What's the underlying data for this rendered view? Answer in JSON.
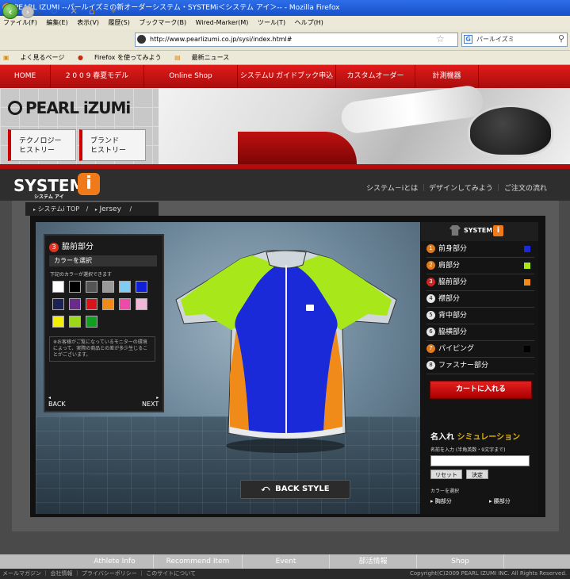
{
  "browser": {
    "title": "PEARL IZUMI --パールイズミの新オーダーシステム・SYSTEMi＜システム アイ＞-- - Mozilla Firefox",
    "menu": [
      "ファイル(F)",
      "編集(E)",
      "表示(V)",
      "履歴(S)",
      "ブックマーク(B)",
      "Wired-Marker(M)",
      "ツール(T)",
      "ヘルプ(H)"
    ],
    "url": "http://www.pearlizumi.co.jp/sysi/index.html#",
    "search": "パールイズミ",
    "bookmarks": [
      "よく見るページ",
      "Firefox を使ってみよう",
      "最新ニュース"
    ]
  },
  "site_nav": [
    "HOME",
    "2 0 0 9 春夏モデル",
    "Online Shop",
    "システムU ガイドブック申込",
    "カスタムオーダー",
    "計測機器"
  ],
  "banner": {
    "logo": "PEARL iZUMi",
    "btn_tech": [
      "テクノロジー",
      "ヒストリー"
    ],
    "btn_brand": [
      "ブランド",
      "ヒストリー"
    ]
  },
  "system": {
    "logo": "SYSTEM",
    "logo_sub": "システム アイ",
    "logo_i": "i",
    "links": [
      "システム－iとは",
      "デザインしてみよう",
      "ご注文の流れ"
    ]
  },
  "breadcrumb": {
    "home": "システムi TOP",
    "sep": "/",
    "current": "Jersey"
  },
  "left_panel": {
    "badge": "3",
    "title": "脇前部分",
    "subtitle": "カラーを選択",
    "hint": "下記のカラーが選択できます",
    "swatches": [
      "#ffffff",
      "#000000",
      "#555555",
      "#999999",
      "#7ecdf2",
      "#1020d8",
      "#1c2254",
      "#6a2c8a",
      "#d8141a",
      "#f08a18",
      "#f04aa8",
      "#f2b6d8",
      "#f2f000",
      "#9cd81a",
      "#10a020"
    ],
    "note": "※お客様がご覧になっているモニターの環境によって、実際の商品との差が多少生じることがございます。",
    "back": "BACK",
    "next": "NEXT"
  },
  "jersey_colors": {
    "front": "#1a2ad8",
    "shoulder": "#a8e81a",
    "side": "#f08a18",
    "trim": "#cfd6dc",
    "piping": "#111111"
  },
  "back_style": "BACK STYLE",
  "right_panel": {
    "header": "SYSTEM",
    "header_i": "i",
    "parts": [
      {
        "n": "1",
        "label": "前身部分",
        "color": "#1a2ad8",
        "badge": "#e07a1a"
      },
      {
        "n": "2",
        "label": "肩部分",
        "color": "#a8e81a",
        "badge": "#e07a1a"
      },
      {
        "n": "3",
        "label": "脇前部分",
        "color": "#f08a18",
        "badge": "#d32222"
      },
      {
        "n": "4",
        "label": "襟部分",
        "color": "",
        "badge": "#e8e8e8"
      },
      {
        "n": "5",
        "label": "背中部分",
        "color": "",
        "badge": "#e8e8e8"
      },
      {
        "n": "6",
        "label": "脇横部分",
        "color": "",
        "badge": "#e8e8e8"
      },
      {
        "n": "7",
        "label": "パイピング",
        "color": "#000000",
        "badge": "#e07a1a"
      },
      {
        "n": "8",
        "label": "ファスナー部分",
        "color": "",
        "badge": "#e8e8e8"
      }
    ],
    "cart": "カートに入れる",
    "sim_a": "名入れ",
    "sim_b": "シミュレーション",
    "name_label": "名前を入力 (半角英数・9文字まで)",
    "name_value": "",
    "reset": "リセット",
    "decide": "決定",
    "color_label": "カラーを選択",
    "chest": "胸部分",
    "waist": "腰部分"
  },
  "footer": {
    "items": [
      "Athlete Info",
      "Recommend Item",
      "Event",
      "部活情報",
      "Shop"
    ],
    "links": "メールマガジン ｜ 会社情報 ｜ プライバシーポリシー ｜ このサイトについて",
    "copyright": "Copyright(C)2009 PEARL IZUMI INC. All Rights Reserved."
  }
}
